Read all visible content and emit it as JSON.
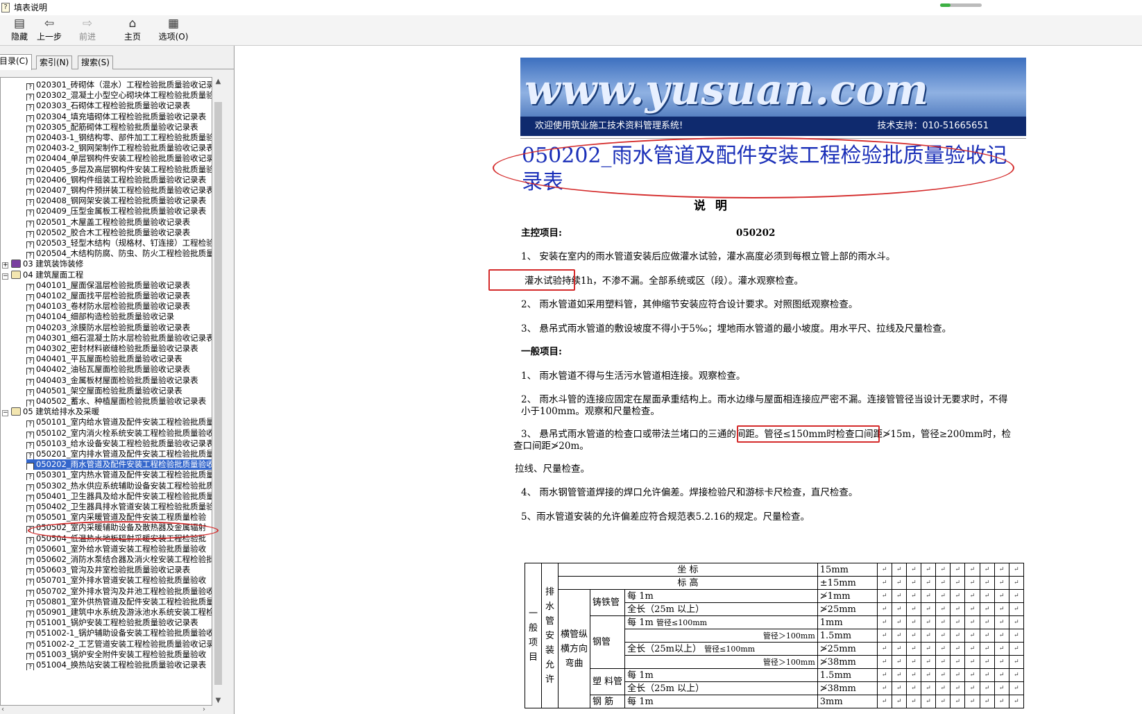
{
  "window": {
    "title": "填表说明",
    "progress": 0.25,
    "progress_color": "#3cb043"
  },
  "toolbar": {
    "hide": {
      "label": "隐藏",
      "icon": "hide-pane-icon"
    },
    "back": {
      "label": "上一步",
      "icon": "back-arrow-icon"
    },
    "forward": {
      "label": "前进",
      "icon": "forward-arrow-icon"
    },
    "home": {
      "label": "主页",
      "icon": "home-icon"
    },
    "options": {
      "label": "选项(O)",
      "icon": "options-icon"
    }
  },
  "tabs": [
    "目录(C)",
    "索引(N)",
    "搜索(S)"
  ],
  "tree": [
    {
      "t": "doc",
      "text": "020301_砖砌体（混水）工程检验批质量验收记录"
    },
    {
      "t": "doc",
      "text": "020302_混凝土小型空心砌块体工程检验批质量验"
    },
    {
      "t": "doc",
      "text": "020303_石砌体工程检验批质量验收记录表"
    },
    {
      "t": "doc",
      "text": "020304_填充墙砌体工程检验批质量验收记录表"
    },
    {
      "t": "doc",
      "text": "020305_配筋砌体工程检验批质量验收记录表"
    },
    {
      "t": "doc",
      "text": "020403-1_钢结构零、部件加工工程检验批质量验"
    },
    {
      "t": "doc",
      "text": "020403-2_钢网架制作工程检验批质量验收记录表"
    },
    {
      "t": "doc",
      "text": "020404_单层钢构件安装工程检验批质量验收记录"
    },
    {
      "t": "doc",
      "text": "020405_多层及高层钢构件安装工程检验批质量验"
    },
    {
      "t": "doc",
      "text": "020406_钢构件组装工程检验批质量验收记录表"
    },
    {
      "t": "doc",
      "text": "020407_钢构件预拼装工程检验批质量验收记录表"
    },
    {
      "t": "doc",
      "text": "020408_钢网架安装工程检验批质量验收记录表"
    },
    {
      "t": "doc",
      "text": "020409_压型金属板工程检验批质量验收记录表"
    },
    {
      "t": "doc",
      "text": "020501_木屋盖工程检验批质量验收记录表"
    },
    {
      "t": "doc",
      "text": "020502_胶合木工程检验批质量验收记录表"
    },
    {
      "t": "doc",
      "text": "020503_轻型木结构（规格材、钉连接）工程检验"
    },
    {
      "t": "doc",
      "text": "020504_木结构防腐、防虫、防火工程检验批质量"
    },
    {
      "t": "folder",
      "text": "03  建筑装饰装修",
      "pm": "+",
      "open": false
    },
    {
      "t": "folder",
      "text": "04  建筑屋面工程",
      "pm": "−",
      "open": true
    },
    {
      "t": "doc",
      "text": "040101_屋面保温层检验批质量验收记录表"
    },
    {
      "t": "doc",
      "text": "040102_屋面找平层检验批质量验收记录表"
    },
    {
      "t": "doc",
      "text": "040103_卷材防水层检验批质量验收记录表"
    },
    {
      "t": "doc",
      "text": "040104_细部构造检验批质量验收记录"
    },
    {
      "t": "doc",
      "text": "040203_涂膜防水层检验批质量验收记录表"
    },
    {
      "t": "doc",
      "text": "040301_细石混凝土防水层检验批质量验收记录表"
    },
    {
      "t": "doc",
      "text": "040302_密封材料嵌缝检验批质量验收记录表"
    },
    {
      "t": "doc",
      "text": "040401_平瓦屋面检验批质量验收记录表"
    },
    {
      "t": "doc",
      "text": "040402_油毡瓦屋面检验批质量验收记录表"
    },
    {
      "t": "doc",
      "text": "040403_金属板材屋面检验批质量验收记录表"
    },
    {
      "t": "doc",
      "text": "040501_架空屋面检验批质量验收记录表"
    },
    {
      "t": "doc",
      "text": "040502_蓄水、种植屋面检验批质量验收记录表"
    },
    {
      "t": "folder",
      "text": "05  建筑给排水及采暖",
      "pm": "−",
      "open": true
    },
    {
      "t": "doc",
      "text": "050101_室内给水管道及配件安装工程检验批质量"
    },
    {
      "t": "doc",
      "text": "050102_室内消火栓系统安装工程检验批质量验收"
    },
    {
      "t": "doc",
      "text": "050103_给水设备安装工程检验批质量验收记录表"
    },
    {
      "t": "doc",
      "text": "050201_室内排水管道及配件安装工程检验批质量"
    },
    {
      "t": "doc",
      "text": "050202_雨水管道及配件安装工程检验批质量验收",
      "sel": true
    },
    {
      "t": "doc",
      "text": "050301_室内热水管道及配件安装工程检验批质量"
    },
    {
      "t": "doc",
      "text": "050302_热水供应系统辅助设备安装工程检验批质"
    },
    {
      "t": "doc",
      "text": "050401_卫生器具及给水配件安装工程检验批质量"
    },
    {
      "t": "doc",
      "text": "050402_卫生器具排水管道安装工程检验批质量验"
    },
    {
      "t": "doc",
      "text": "050501_室内采暖管道及配件安装工程质量检验"
    },
    {
      "t": "doc",
      "text": "050502_室内采暖辅助设备及散热器及金属辐射"
    },
    {
      "t": "doc",
      "text": "050504_低温热水地板辐射采暖安装工程检验批"
    },
    {
      "t": "doc",
      "text": "050601_室外给水管道安装工程检验批质量验收"
    },
    {
      "t": "doc",
      "text": "050602_消防水泵结合器及消火栓安装工程检验批"
    },
    {
      "t": "doc",
      "text": "050603_管沟及井室检验批质量验收记录表"
    },
    {
      "t": "doc",
      "text": "050701_室外排水管道安装工程检验批质量验收"
    },
    {
      "t": "doc",
      "text": "050702_室外排水管沟及井池工程检验批质量验收"
    },
    {
      "t": "doc",
      "text": "050801_室外供热管道及配件安装工程检验批质量"
    },
    {
      "t": "doc",
      "text": "050901_建筑中水系统及游泳池水系统安装工程检"
    },
    {
      "t": "doc",
      "text": "051001_锅炉安装工程检验批质量验收记录表"
    },
    {
      "t": "doc",
      "text": "051002-1_锅炉辅助设备安装工程检验批质量验收"
    },
    {
      "t": "doc",
      "text": "051002-2_工艺管道安装工程检验批质量验收记录"
    },
    {
      "t": "doc",
      "text": "051003_锅炉安全附件安装工程检验批质量验收"
    },
    {
      "t": "doc",
      "text": "051004_换热站安装工程检验批质量验收记录表"
    }
  ],
  "banner": {
    "logo": "www.yusuan.com",
    "welcome": "欢迎使用筑业施工技术资料管理系统!",
    "support": "技术支持：010-51665651"
  },
  "doc": {
    "title": "050202_雨水管道及配件安装工程检验批质量验收记录表",
    "heading": "说 明",
    "main_label": "主控项目:",
    "code": "050202",
    "m1": "1、 安装在室内的雨水管道安装后应做灌水试验，灌水高度必须到每根立管上部的雨水斗。",
    "m1b": "灌水试验持续1h，不渗不漏。全部系统或区（段）。灌水观察检查。",
    "m2": "2、 雨水管道如采用塑料管，其伸缩节安装应符合设计要求。对照图纸观察检查。",
    "m3": "3、 悬吊式雨水管道的敷设坡度不得小于5‰；埋地雨水管道的最小坡度。用水平尺、拉线及尺量检查。",
    "general_label": "一般项目:",
    "g1": "1、 雨水管道不得与生活污水管道相连接。观察检查。",
    "g2": "2、 雨水斗管的连接应固定在屋面承重结构上。雨水边缘与屋面相连接应严密不漏。连接管管径当设计无要求时，不得小于100mm。观察和尺量检查。",
    "g3a": "3、 悬吊式雨水管道的检查口或带法兰堵口的三通的间距。",
    "g3b": "管径≤150mm时检查口间距≯15m",
    "g3c": "，管径≥200mm时，检",
    "g3d": "查口间距≯20m。",
    "g3e": "拉线、尺量检查。",
    "g4": "4、 雨水钢管管道焊接的焊口允许偏差。焊接检验尺和游标卡尺检查，直尺检查。",
    "g5": "5、雨水管道安装的允许偏差应符合规范表5.2.16的规定。尺量检查。"
  },
  "table": {
    "col_general": "一般项目",
    "col_drain": "排水管安装允许",
    "row_zuobiao": "坐    标",
    "row_biaogao": "标    高",
    "v_zuobiao": "15mm",
    "v_biaogao": "±15mm",
    "zhutie": "铸铁管",
    "per1m": "每 1m",
    "quanchang": "全长（25m 以上）",
    "v_zt1": "≯1mm",
    "v_zt2": "≯25mm",
    "hengguan": "横管纵横方向弯曲",
    "gangguan": "钢管",
    "d_le100": "管径≤100mm",
    "d_gt100": "管径＞100mm",
    "quanchang2": "全长（25m以上）",
    "v_g1": "1mm",
    "v_g2": "1.5mm",
    "v_g3": "≯25mm",
    "v_g4": "≯38mm",
    "suliao": "塑 料管",
    "v_s1": "1.5mm",
    "v_s2": "≯38mm",
    "gangjin": "钢 筋",
    "v_gj1": "3mm",
    "arrow": "↵"
  }
}
